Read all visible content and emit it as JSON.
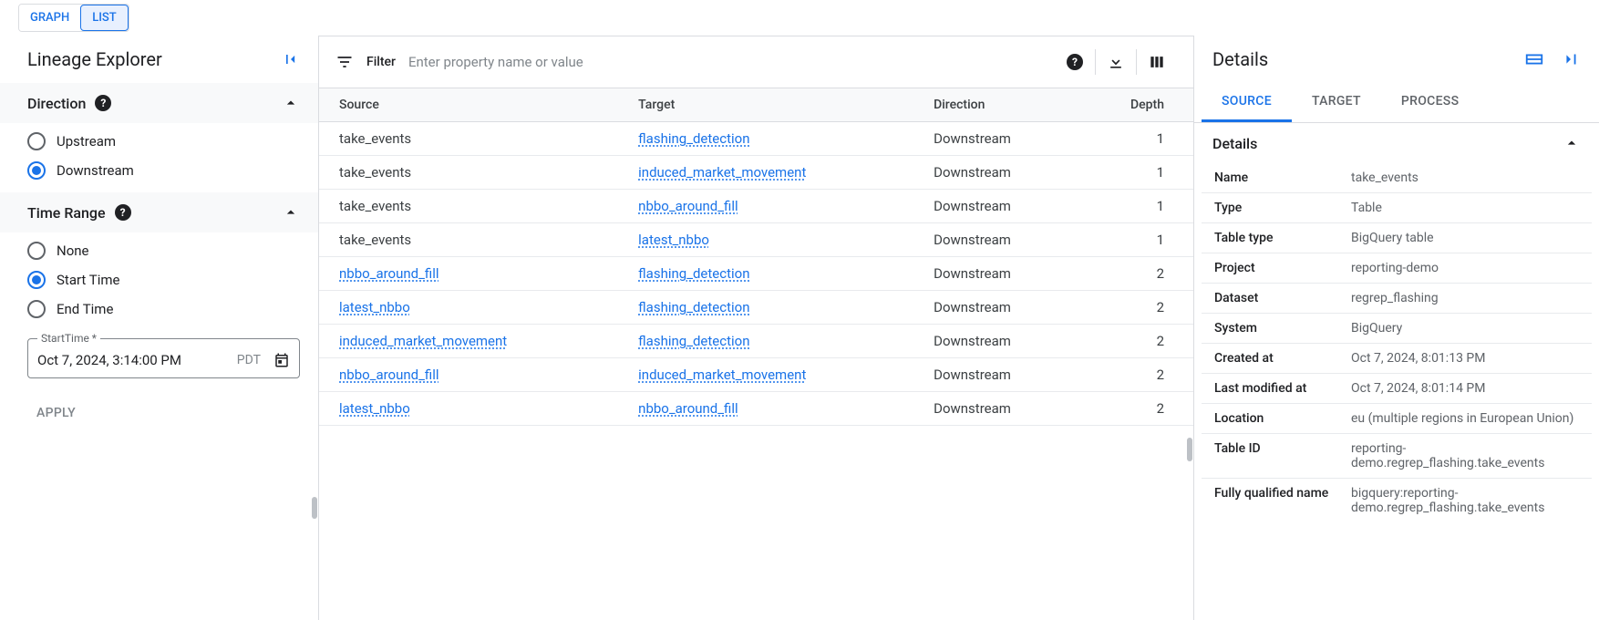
{
  "view_toggle": {
    "graph": "GRAPH",
    "list": "LIST",
    "selected": "list"
  },
  "left": {
    "title": "Lineage Explorer",
    "direction": {
      "header": "Direction",
      "options": {
        "upstream": "Upstream",
        "downstream": "Downstream"
      },
      "selected": "downstream"
    },
    "time_range": {
      "header": "Time Range",
      "options": {
        "none": "None",
        "start": "Start Time",
        "end": "End Time"
      },
      "selected": "start",
      "field_label": "StartTime *",
      "value": "Oct 7, 2024, 3:14:00 PM",
      "tz": "PDT"
    },
    "apply": "APPLY"
  },
  "filter": {
    "label": "Filter",
    "placeholder": "Enter property name or value"
  },
  "table": {
    "headers": {
      "source": "Source",
      "target": "Target",
      "direction": "Direction",
      "depth": "Depth"
    },
    "rows": [
      {
        "source": "take_events",
        "source_link": false,
        "target": "flashing_detection",
        "target_link": true,
        "direction": "Downstream",
        "depth": "1"
      },
      {
        "source": "take_events",
        "source_link": false,
        "target": "induced_market_movement",
        "target_link": true,
        "direction": "Downstream",
        "depth": "1"
      },
      {
        "source": "take_events",
        "source_link": false,
        "target": "nbbo_around_fill",
        "target_link": true,
        "direction": "Downstream",
        "depth": "1"
      },
      {
        "source": "take_events",
        "source_link": false,
        "target": "latest_nbbo",
        "target_link": true,
        "direction": "Downstream",
        "depth": "1"
      },
      {
        "source": "nbbo_around_fill",
        "source_link": true,
        "target": "flashing_detection",
        "target_link": true,
        "direction": "Downstream",
        "depth": "2"
      },
      {
        "source": "latest_nbbo",
        "source_link": true,
        "target": "flashing_detection",
        "target_link": true,
        "direction": "Downstream",
        "depth": "2"
      },
      {
        "source": "induced_market_movement",
        "source_link": true,
        "target": "flashing_detection",
        "target_link": true,
        "direction": "Downstream",
        "depth": "2"
      },
      {
        "source": "nbbo_around_fill",
        "source_link": true,
        "target": "induced_market_movement",
        "target_link": true,
        "direction": "Downstream",
        "depth": "2"
      },
      {
        "source": "latest_nbbo",
        "source_link": true,
        "target": "nbbo_around_fill",
        "target_link": true,
        "direction": "Downstream",
        "depth": "2"
      }
    ]
  },
  "details": {
    "title": "Details",
    "tabs": {
      "source": "SOURCE",
      "target": "TARGET",
      "process": "PROCESS"
    },
    "subheader": "Details",
    "rows": [
      {
        "k": "Name",
        "v": "take_events"
      },
      {
        "k": "Type",
        "v": "Table"
      },
      {
        "k": "Table type",
        "v": "BigQuery table"
      },
      {
        "k": "Project",
        "v": "reporting-demo"
      },
      {
        "k": "Dataset",
        "v": "regrep_flashing"
      },
      {
        "k": "System",
        "v": "BigQuery"
      },
      {
        "k": "Created at",
        "v": "Oct 7, 2024, 8:01:13 PM"
      },
      {
        "k": "Last modified at",
        "v": "Oct 7, 2024, 8:01:14 PM"
      },
      {
        "k": "Location",
        "v": "eu (multiple regions in European Union)"
      },
      {
        "k": "Table ID",
        "v": "reporting-demo.regrep_flashing.take_events"
      },
      {
        "k": "Fully qualified name",
        "v": "bigquery:reporting-demo.regrep_flashing.take_events"
      }
    ]
  }
}
